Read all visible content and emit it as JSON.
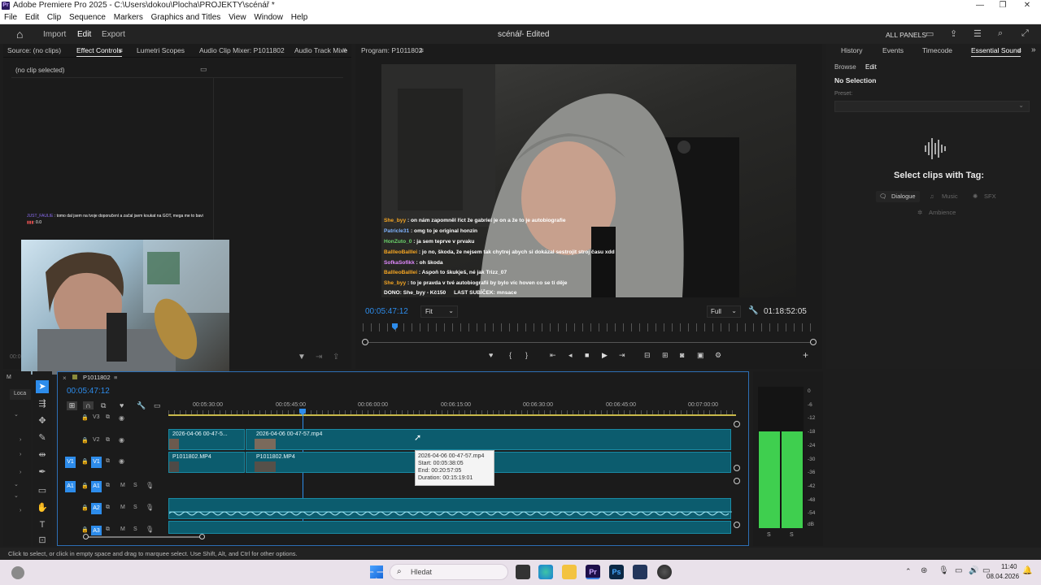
{
  "window": {
    "title": "Adobe Premiere Pro 2025 - C:\\Users\\dokou\\Plocha\\PROJEKTY\\scénář *",
    "app_badge": "Pr",
    "minimize": "—",
    "restore": "❐",
    "close": "✕"
  },
  "menu": [
    "File",
    "Edit",
    "Clip",
    "Sequence",
    "Markers",
    "Graphics and Titles",
    "View",
    "Window",
    "Help"
  ],
  "workspace": {
    "home": "⌂",
    "import": "Import",
    "edit": "Edit",
    "export": "Export",
    "project_title": "scénář",
    "project_status": "- Edited",
    "all_panels": "ALL PANELS"
  },
  "left_panel": {
    "tabs": [
      "Source: (no clips)",
      "Effect Controls",
      "Lumetri Scopes",
      "Audio Clip Mixer: P1011802",
      "Audio Track Mixe"
    ],
    "no_clip": "(no clip selected)",
    "timecode": "00:0",
    "overlay_chat_user": "JUST_FAULIE",
    "overlay_chat_text": ": tomo dal jsem na tvoje doporučení a začal jsem koukat na GOT, mega me to bavi",
    "overlay_chat_line2": ": 0.0"
  },
  "program": {
    "tab": "Program: P1011802",
    "timecode": "00:05:47:12",
    "fit": "Fit",
    "full": "Full",
    "duration": "01:18:52:05",
    "chat": [
      {
        "user": "She_byy",
        "text": ": on nám zapomněl říct že gabriel je on a že to je autobiografie",
        "cls": "u1"
      },
      {
        "user": "Patricle31",
        "text": ": omg to je original honzin",
        "cls": "u2"
      },
      {
        "user": "HonZuto_0",
        "text": ": ja sem teprve v prvaku",
        "cls": "u4"
      },
      {
        "user": "BallleoBalllei",
        "text": ": jo no, škoda, že nejsem tak chytrej abych si dokázal sestrojit stroj času xdd",
        "cls": "u1"
      },
      {
        "user": "SofkaSofikk",
        "text": ": oh škoda",
        "cls": "u3"
      },
      {
        "user": "BallleoBalllei",
        "text": ": Aspoň to škukješ, né jak Trizz_07",
        "cls": "u1"
      },
      {
        "user": "She_byy",
        "text": ": to je pravda v tvé autobiografii by bylo víc hoven co se tí děje",
        "cls": "u1"
      }
    ],
    "dono": "DONO: She_byy - Kč150",
    "last_sub": "LAST SUBÍČEK: mnsace"
  },
  "right_panel": {
    "tabs": [
      "History",
      "Events",
      "Timecode",
      "Essential Sound"
    ],
    "subtabs": [
      "Browse",
      "Edit"
    ],
    "no_selection": "No Selection",
    "preset_label": "Preset:",
    "select_heading": "Select clips with Tag:",
    "tags": [
      "Dialogue",
      "Music",
      "SFX",
      "Ambience"
    ]
  },
  "timeline": {
    "panel_short": "M",
    "panel_short2": "Loca",
    "sequence": "P1011802",
    "timecode": "00:05:47:12",
    "ruler": [
      "00:05:30:00",
      "00:05:45:00",
      "00:06:00:00",
      "00:06:15:00",
      "00:06:30:00",
      "00:06:45:00",
      "00:07:00:00"
    ],
    "tracks": [
      "V3",
      "V2",
      "V1",
      "A1",
      "A2",
      "A3"
    ],
    "clips": {
      "v2a": "2026-04-06 00-47-5...",
      "v2b": "2026-04-06 00-47-57.mp4",
      "v1a": "P1011802.MP4",
      "v1b": "P1011802.MP4"
    },
    "tooltip": {
      "name": "2026-04-06 00-47-57.mp4",
      "start": "Start: 00:05:38:05",
      "end": "End: 00:20:57:05",
      "duration": "Duration: 00:15:19:01"
    }
  },
  "meter": {
    "scale": [
      "0",
      "-6",
      "-12",
      "-18",
      "-24",
      "-30",
      "-36",
      "-42",
      "-48",
      "-54",
      "dB"
    ],
    "solo": [
      "S",
      "S"
    ],
    "level_left": 0.31,
    "level_right": 0.31
  },
  "status_bar": "Click to select, or click in empty space and drag to marquee select. Use Shift, Alt, and Ctrl for other options.",
  "taskbar": {
    "search": "Hledat",
    "time": "11:40",
    "date": "08.04.2026"
  },
  "colors": {
    "accent": "#2d8ceb",
    "clip": "#0c5c6e",
    "meter_green": "#3fcf4f"
  }
}
